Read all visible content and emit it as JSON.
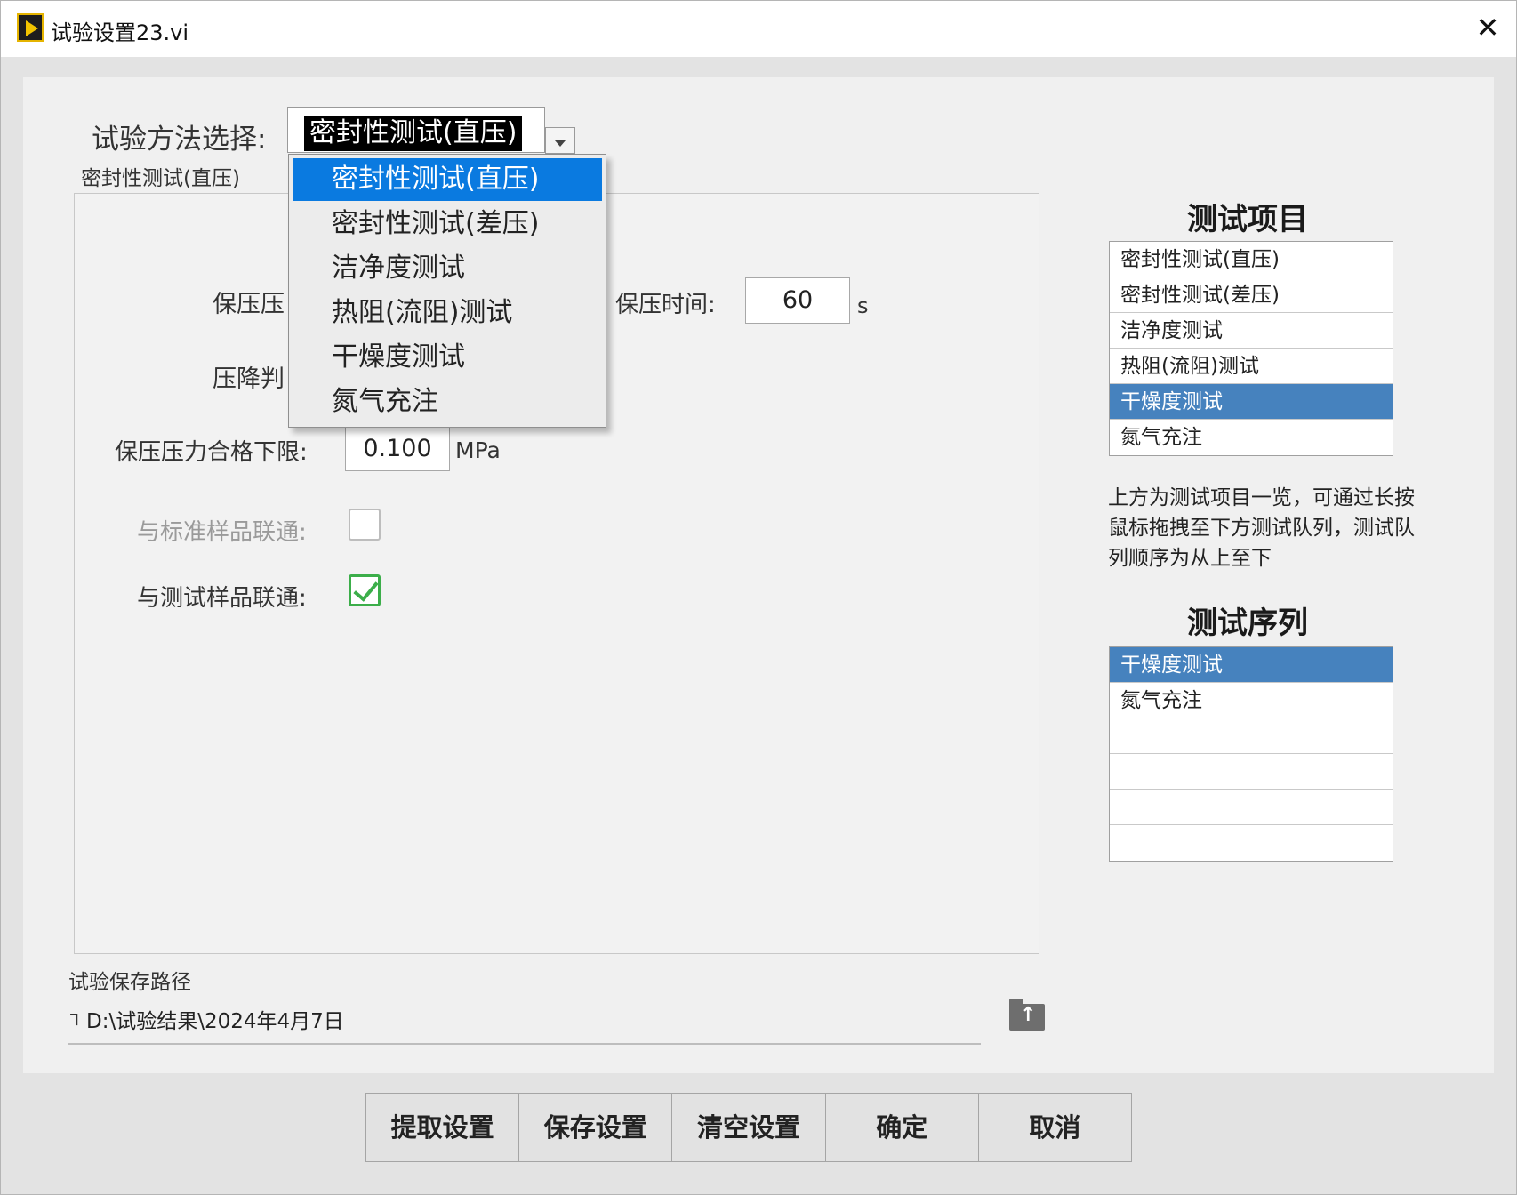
{
  "window": {
    "title": "试验设置23.vi"
  },
  "method": {
    "label": "试验方法选择:",
    "value": "密封性测试(直压)",
    "caption": "密封性测试(直压)",
    "options": [
      "密封性测试(直压)",
      "密封性测试(差压)",
      "洁净度测试",
      "热阻(流阻)测试",
      "干燥度测试",
      "氮气充注"
    ],
    "selected_index": 0
  },
  "settings": {
    "hold_pressure_label_partial": "保压压",
    "drop_judge_label_partial": "压降判",
    "hold_time_label": "保压时间:",
    "hold_time_value": "60",
    "hold_time_unit": "s",
    "lower_limit_label": "保压压力合格下限:",
    "lower_limit_value": "0.100",
    "lower_limit_unit": "MPa",
    "std_sample_label": "与标准样品联通:",
    "std_sample_checked": false,
    "test_sample_label": "与测试样品联通:",
    "test_sample_checked": true
  },
  "test_items": {
    "title": "测试项目",
    "rows": [
      "密封性测试(直压)",
      "密封性测试(差压)",
      "洁净度测试",
      "热阻(流阻)测试",
      "干燥度测试",
      "氮气充注"
    ],
    "highlighted_index": 4
  },
  "note": "上方为测试项目一览，可通过长按鼠标拖拽至下方测试队列，测试队列顺序为从上至下",
  "test_sequence": {
    "title": "测试序列",
    "rows": [
      "干燥度测试",
      "氮气充注",
      "",
      "",
      "",
      ""
    ],
    "highlighted_index": 0
  },
  "save_path": {
    "label": "试验保存路径",
    "value": "D:\\试验结果\\2024年4月7日"
  },
  "buttons": {
    "fetch": "提取设置",
    "save": "保存设置",
    "clear": "清空设置",
    "ok": "确定",
    "cancel": "取消"
  },
  "colors": {
    "highlight_blue": "#4682be",
    "dropdown_selected": "#0a7ae0",
    "check_green": "#3cae4a"
  }
}
